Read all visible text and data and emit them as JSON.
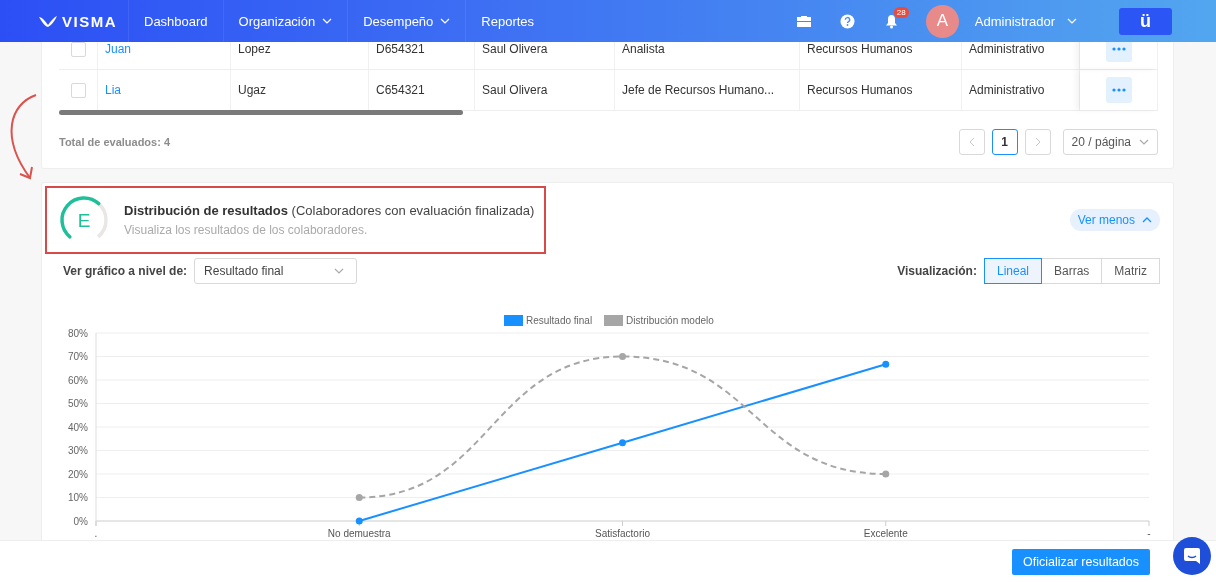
{
  "header": {
    "logo": "VISMA",
    "nav": [
      {
        "label": "Dashboard",
        "dropdown": false
      },
      {
        "label": "Organización",
        "dropdown": true
      },
      {
        "label": "Desempeño",
        "dropdown": true
      },
      {
        "label": "Reportes",
        "dropdown": false
      }
    ],
    "notifications_badge": "28",
    "avatar_letter": "A",
    "user_name": "Administrador",
    "app_button": "ü"
  },
  "table": {
    "rows": [
      {
        "checked": false,
        "cells": [
          "Juan",
          "Lopez",
          "D654321",
          "Saul Olivera",
          "Analista",
          "Recursos Humanos",
          "Administrativo"
        ]
      },
      {
        "checked": false,
        "cells": [
          "Lia",
          "Ugaz",
          "C654321",
          "Saul Olivera",
          "Jefe de Recursos Humano...",
          "Recursos Humanos",
          "Administrativo"
        ]
      }
    ],
    "total": "Total de evaluados: 4",
    "pagination": {
      "prev_disabled": true,
      "next_disabled": true,
      "pages": [
        {
          "label": "1",
          "selected": true
        }
      ],
      "page_size": "20 / página"
    }
  },
  "results": {
    "gauge": {
      "letter": "E",
      "level": 0.65
    },
    "title": "**Distribución de resultados** (Colaboradores con evaluación finalizada)",
    "subtitle": "Visualiza los resultados de los colaboradores.",
    "toggle": "Ver menos",
    "level_label": "Ver gráfico a nivel de:",
    "level_select": "Resultado final",
    "view_label": "Visualización:",
    "views": [
      {
        "label": "Lineal",
        "selected": true
      },
      {
        "label": "Barras",
        "selected": false
      },
      {
        "label": "Matriz",
        "selected": false
      }
    ],
    "chart_data": {
      "type": "line",
      "categories": [
        ".",
        "No demuestra",
        "Satisfactorio",
        "Excelente",
        "-"
      ],
      "grid": true,
      "legend": true,
      "series": [
        {
          "name": "Resultado final",
          "color": "#1890ff",
          "line_style": "solid",
          "marker": "circle",
          "values": [
            null,
            0,
            33.3,
            66.7,
            null
          ]
        },
        {
          "name": "Distribución modelo",
          "color": "#a6a6a6",
          "line_style": "dashed",
          "marker": "circle",
          "values": [
            null,
            10,
            70,
            20,
            null
          ]
        }
      ],
      "ylim": [
        0,
        80
      ],
      "yticks": [
        {
          "value": 0,
          "label": "0%"
        },
        {
          "value": 10,
          "label": "10%"
        },
        {
          "value": 20,
          "label": "20%"
        },
        {
          "value": 30,
          "label": "30%"
        },
        {
          "value": 40,
          "label": "40%"
        },
        {
          "value": 50,
          "label": "50%"
        },
        {
          "value": 60,
          "label": "60%"
        },
        {
          "value": 70,
          "label": "70%"
        },
        {
          "value": 80,
          "label": "80%"
        }
      ]
    }
  },
  "bottom_bar": {
    "primary_button": "Oficializar resultados"
  }
}
